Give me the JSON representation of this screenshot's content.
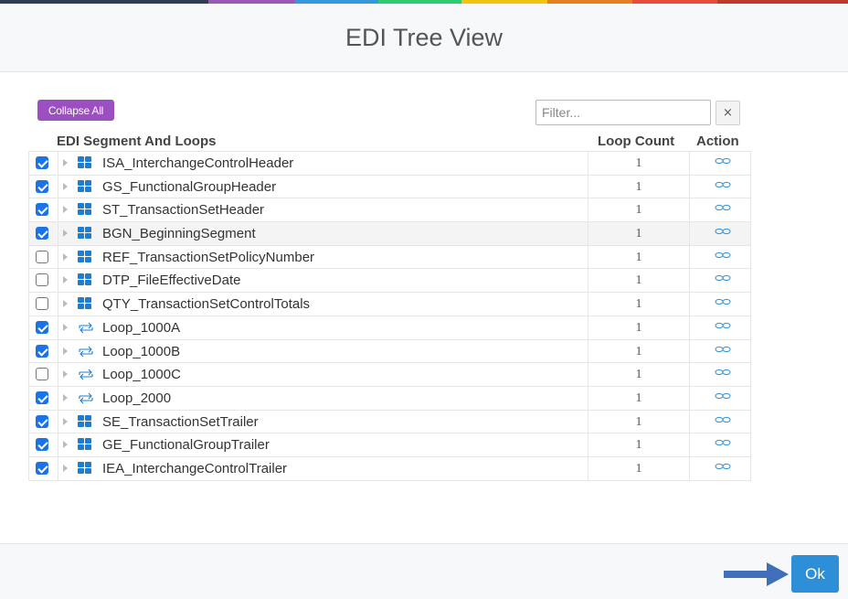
{
  "colors": {
    "top_stripe": [
      "#2c3e50",
      "#2c3e50",
      "#2c3e50",
      "#9b59b6",
      "#3498db",
      "#2ecc71",
      "#f1c40f",
      "#e67e22",
      "#e74c3c",
      "#c0392b"
    ],
    "accent_purple": "#9b4fc0",
    "accent_blue": "#2c8fd8",
    "icon_blue": "#1a7fd4",
    "arrow_blue": "#3f6fb8"
  },
  "dialog": {
    "title": "EDI Tree View"
  },
  "toolbar": {
    "collapse_all_label": "Collapse All",
    "filter_placeholder": "Filter...",
    "filter_value": "",
    "clear_label": "×"
  },
  "table": {
    "headers": {
      "segment": "EDI Segment And Loops",
      "loop_count": "Loop Count",
      "action": "Action"
    },
    "rows": [
      {
        "checked": true,
        "icon": "segment-icon",
        "name": "ISA_InterchangeControlHeader",
        "count": "1",
        "action_icon": "link-icon"
      },
      {
        "checked": true,
        "icon": "segment-icon",
        "name": "GS_FunctionalGroupHeader",
        "count": "1",
        "action_icon": "link-icon"
      },
      {
        "checked": true,
        "icon": "segment-icon",
        "name": "ST_TransactionSetHeader",
        "count": "1",
        "action_icon": "link-icon"
      },
      {
        "checked": true,
        "icon": "segment-icon",
        "name": "BGN_BeginningSegment",
        "count": "1",
        "action_icon": "link-icon",
        "highlighted": true
      },
      {
        "checked": false,
        "icon": "segment-icon",
        "name": "REF_TransactionSetPolicyNumber",
        "count": "1",
        "action_icon": "link-icon"
      },
      {
        "checked": false,
        "icon": "segment-icon",
        "name": "DTP_FileEffectiveDate",
        "count": "1",
        "action_icon": "link-icon"
      },
      {
        "checked": false,
        "icon": "segment-icon",
        "name": "QTY_TransactionSetControlTotals",
        "count": "1",
        "action_icon": "link-icon"
      },
      {
        "checked": true,
        "icon": "loop-icon",
        "name": "Loop_1000A",
        "count": "1",
        "action_icon": "link-icon"
      },
      {
        "checked": true,
        "icon": "loop-icon",
        "name": "Loop_1000B",
        "count": "1",
        "action_icon": "link-icon"
      },
      {
        "checked": false,
        "icon": "loop-icon",
        "name": "Loop_1000C",
        "count": "1",
        "action_icon": "link-icon"
      },
      {
        "checked": true,
        "icon": "loop-icon",
        "name": "Loop_2000",
        "count": "1",
        "action_icon": "link-icon"
      },
      {
        "checked": true,
        "icon": "segment-icon",
        "name": "SE_TransactionSetTrailer",
        "count": "1",
        "action_icon": "link-icon"
      },
      {
        "checked": true,
        "icon": "segment-icon",
        "name": "GE_FunctionalGroupTrailer",
        "count": "1",
        "action_icon": "link-icon"
      },
      {
        "checked": true,
        "icon": "segment-icon",
        "name": "IEA_InterchangeControlTrailer",
        "count": "1",
        "action_icon": "link-icon"
      }
    ]
  },
  "footer": {
    "ok_label": "Ok",
    "pointer_icon": "arrow-right-icon"
  }
}
